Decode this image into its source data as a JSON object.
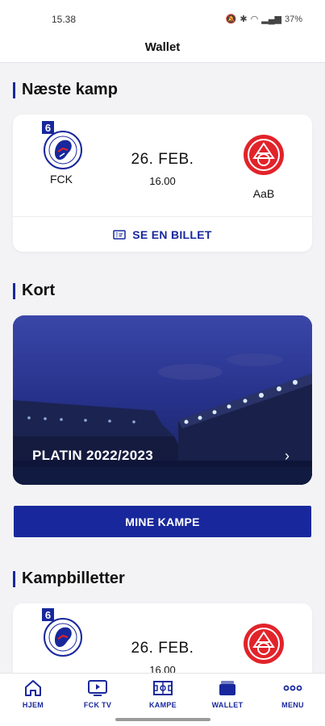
{
  "status_bar": {
    "time": "15.38",
    "battery": "37%"
  },
  "header": {
    "title": "Wallet"
  },
  "next_match": {
    "section_title": "Næste kamp",
    "home_team": "FCK",
    "away_team": "AaB",
    "date": "26. FEB.",
    "time": "16.00",
    "ticket_label": "SE EN BILLET",
    "badge": "6"
  },
  "cards": {
    "section_title": "Kort",
    "season_label": "PLATIN 2022/2023"
  },
  "mine_kampe_label": "MINE KAMPE",
  "match_tickets": {
    "section_title": "Kampbilletter",
    "date": "26. FEB.",
    "time": "16.00",
    "badge": "6"
  },
  "bottom_nav": {
    "home": "HJEM",
    "tv": "FCK TV",
    "matches": "KAMPE",
    "wallet": "WALLET",
    "menu": "MENU"
  },
  "colors": {
    "brand": "#18289c",
    "aab_red": "#e2232a"
  }
}
